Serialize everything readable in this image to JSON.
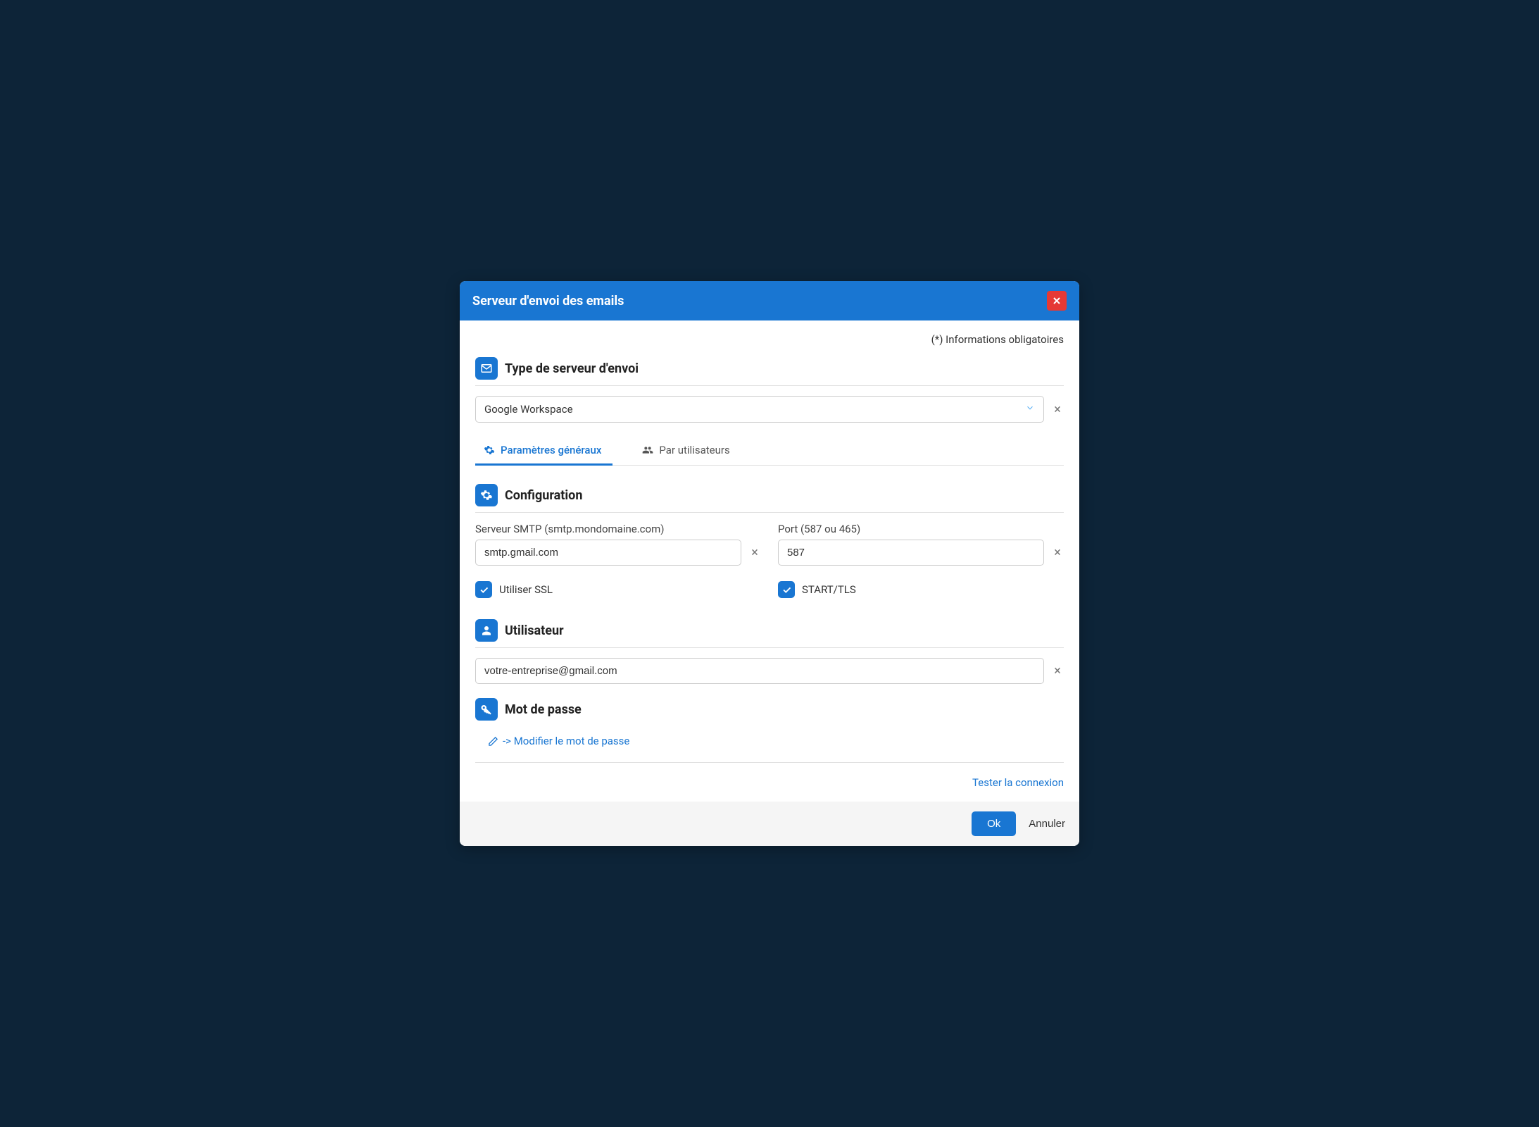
{
  "dialog": {
    "title": "Serveur d'envoi des emails",
    "required_note": "(*) Informations obligatoires"
  },
  "server_type": {
    "heading": "Type de serveur d'envoi",
    "selected": "Google Workspace"
  },
  "tabs": {
    "general": "Paramètres généraux",
    "per_user": "Par utilisateurs"
  },
  "config": {
    "heading": "Configuration",
    "smtp_label": "Serveur SMTP (smtp.mondomaine.com)",
    "smtp_value": "smtp.gmail.com",
    "port_label": "Port (587 ou 465)",
    "port_value": "587",
    "ssl_label": "Utiliser SSL",
    "tls_label": "START/TLS"
  },
  "user": {
    "heading": "Utilisateur",
    "value": "votre-entreprise@gmail.com"
  },
  "password": {
    "heading": "Mot de passe",
    "modify_link": "-> Modifier le mot de passe"
  },
  "actions": {
    "test": "Tester la connexion",
    "ok": "Ok",
    "cancel": "Annuler"
  }
}
